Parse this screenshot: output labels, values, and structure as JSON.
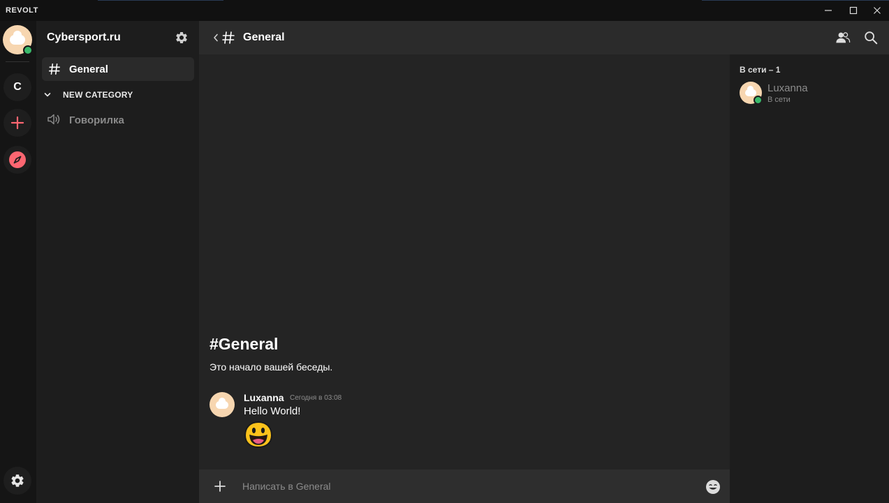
{
  "app": {
    "title": "REVOLT"
  },
  "window_controls": {
    "minimize": "minimize-icon",
    "maximize": "maximize-icon",
    "close": "close-icon"
  },
  "rail": {
    "servers": [
      {
        "initial": "C"
      }
    ],
    "icons": {
      "add": "plus-icon",
      "discover": "compass-icon",
      "settings": "gear-icon"
    },
    "accent": "#fd6671",
    "online_color": "#3aba6b"
  },
  "sidebar": {
    "server_name": "Cybersport.ru",
    "channels": [
      {
        "name": "General",
        "type": "text",
        "active": true
      }
    ],
    "category": {
      "name": "NEW CATEGORY",
      "channels": [
        {
          "name": "Говорилка",
          "type": "voice"
        }
      ]
    }
  },
  "header": {
    "channel_name": "General"
  },
  "chat": {
    "welcome_title": "#General",
    "welcome_subtitle": "Это начало вашей беседы.",
    "messages": [
      {
        "author": "Luxanna",
        "timestamp": "Сегодня в 03:08",
        "text": "Hello World!",
        "emoji": "grinning-face"
      }
    ]
  },
  "composer": {
    "placeholder": "Написать в General"
  },
  "members": {
    "heading": "В сети – 1",
    "list": [
      {
        "name": "Luxanna",
        "status": "В сети"
      }
    ]
  }
}
